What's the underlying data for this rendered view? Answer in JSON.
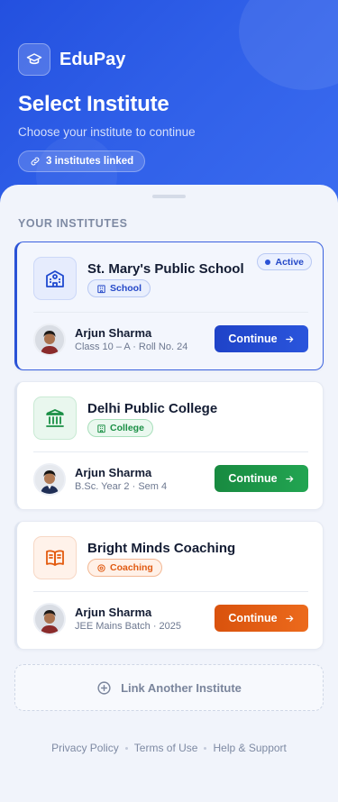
{
  "app": {
    "name": "EduPay"
  },
  "header": {
    "title": "Select Institute",
    "subtitle": "Choose your institute to continue",
    "linked_count_label": "3 institutes linked"
  },
  "section": {
    "label": "YOUR INSTITUTES"
  },
  "colors": {
    "primary": "#2350df",
    "school_accent": "#1f49cf",
    "college_accent": "#1a8f45",
    "coaching_accent": "#e35a0e"
  },
  "institutes": [
    {
      "name": "St. Mary's Public School",
      "type": "School",
      "status": "Active",
      "icon": "school-building-icon",
      "student": {
        "name": "Arjun Sharma",
        "meta": "Class 10 – A · Roll No. 24"
      },
      "action": "Continue"
    },
    {
      "name": "Delhi Public College",
      "type": "College",
      "icon": "college-pillars-icon",
      "student": {
        "name": "Arjun Sharma",
        "meta": "B.Sc. Year 2 · Sem 4"
      },
      "action": "Continue"
    },
    {
      "name": "Bright Minds Coaching",
      "type": "Coaching",
      "icon": "open-book-icon",
      "student": {
        "name": "Arjun Sharma",
        "meta": "JEE Mains Batch · 2025"
      },
      "action": "Continue"
    }
  ],
  "link_another": {
    "label": "Link Another Institute"
  },
  "footer": {
    "links": [
      "Privacy Policy",
      "Terms of Use",
      "Help & Support"
    ]
  }
}
